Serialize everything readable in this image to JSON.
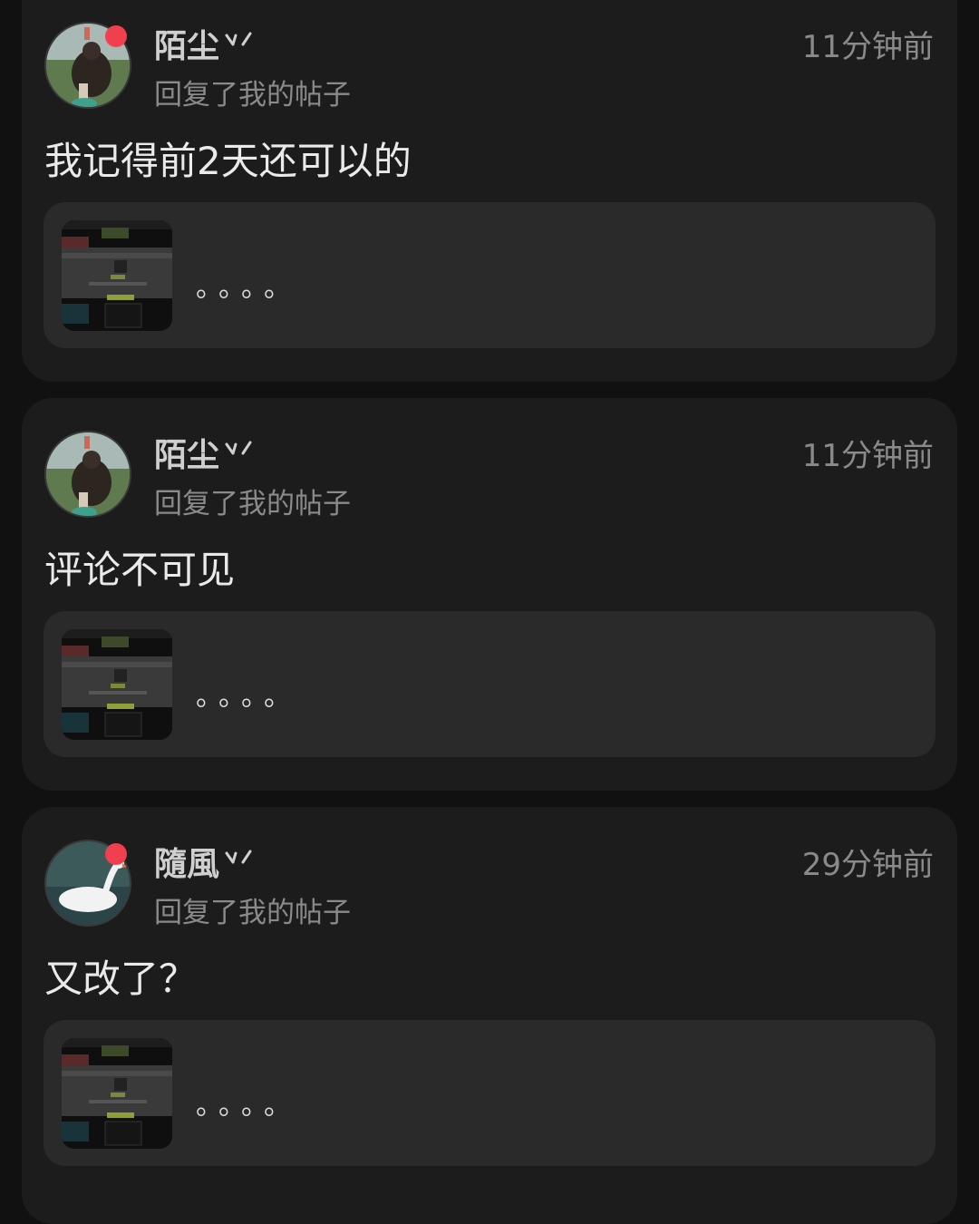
{
  "notifications": [
    {
      "user": "陌尘",
      "action": "回复了我的帖子",
      "time": "11分钟前",
      "content": "我记得前2天还可以的",
      "quote": "。。。。",
      "unread": true,
      "avatar": "bear-avatar"
    },
    {
      "user": "陌尘",
      "action": "回复了我的帖子",
      "time": "11分钟前",
      "content": "评论不可见",
      "quote": "。。。。",
      "unread": false,
      "avatar": "bear-avatar"
    },
    {
      "user": "隨風",
      "action": "回复了我的帖子",
      "time": "29分钟前",
      "content": "又改了？",
      "quote": "。。。。",
      "unread": true,
      "avatar": "swan-avatar"
    }
  ],
  "colors": {
    "background": "#111111",
    "card": "#1c1c1c",
    "quote_box": "#2a2a2a",
    "unread_dot": "#f0404f"
  }
}
